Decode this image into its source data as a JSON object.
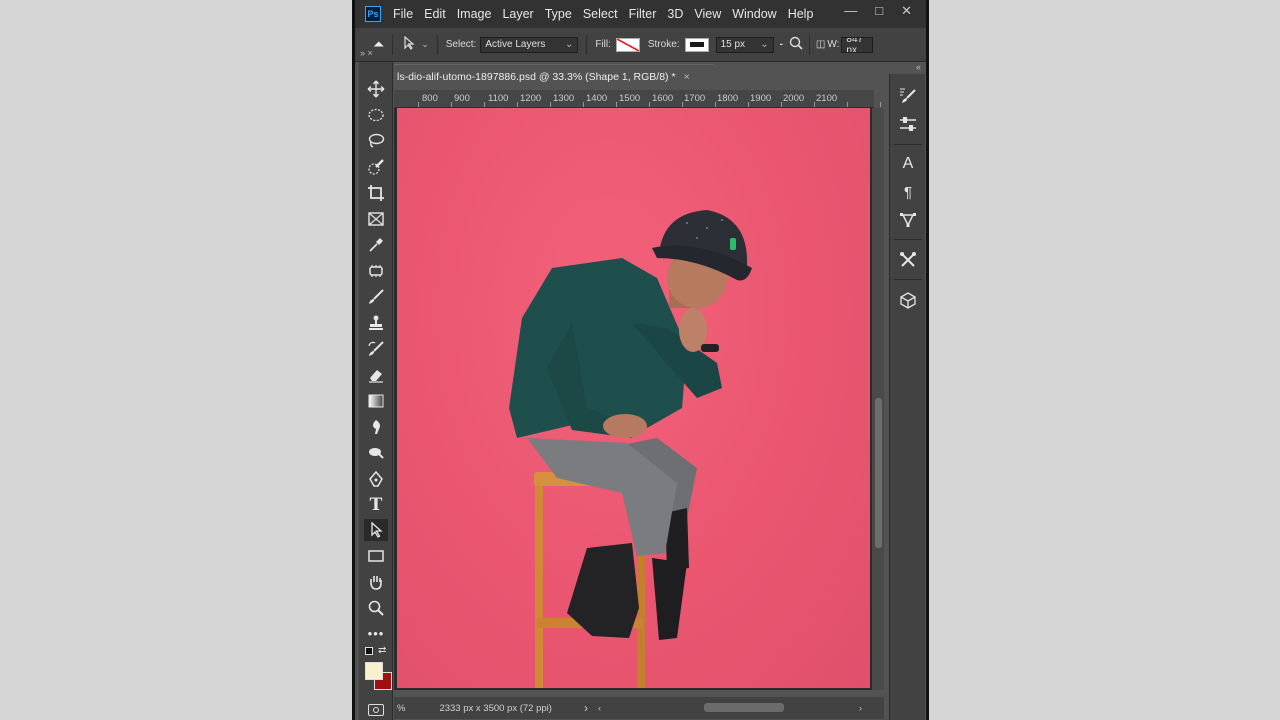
{
  "menubar": {
    "logo": "Ps",
    "items": [
      "File",
      "Edit",
      "Image",
      "Layer",
      "Type",
      "Select",
      "Filter",
      "3D",
      "View",
      "Window",
      "Help"
    ],
    "controls": [
      "—",
      "□",
      "✕"
    ]
  },
  "options": {
    "select_label": "Select:",
    "select_value": "Active Layers",
    "fill_label": "Fill:",
    "stroke_label": "Stroke:",
    "stroke_width": "15 px",
    "width_label": "W:",
    "width_value": "847 px"
  },
  "document": {
    "tab_title": "ls-dio-alif-utomo-1897886.psd @ 33.3% (Shape 1, RGB/8) *",
    "tab_close": "×",
    "ruler_labels": [
      "800",
      "900",
      "1100",
      "1200",
      "1300",
      "1400",
      "1500",
      "1600",
      "1700",
      "1800",
      "1900",
      "2000",
      "2100"
    ],
    "status_prefix": "%",
    "status_text": "2333 px x 3500 px (72 ppi)",
    "status_arrow": "›"
  },
  "toolstrip_head": "» ×",
  "rpanel_head": "«",
  "colors": {
    "background_photo": "#ea5670",
    "foreground_swatch": "#f7f1cf",
    "background_swatch": "#a01010",
    "menubar": "#323232",
    "panel": "#424242"
  },
  "tools": [
    "move-icon",
    "marquee-icon",
    "lasso-icon",
    "quick-select-icon",
    "crop-icon",
    "frame-icon",
    "eyedropper-icon",
    "patch-icon",
    "brush-icon",
    "stamp-icon",
    "history-brush-icon",
    "eraser-icon",
    "gradient-icon",
    "blur-icon",
    "dodge-icon",
    "pen-icon",
    "type-icon",
    "path-select-icon",
    "rectangle-icon",
    "hand-icon",
    "zoom-icon",
    "more-tools-icon"
  ],
  "right_panel_icons": [
    "brush-settings-icon",
    "adjustments-icon",
    "character-icon",
    "paragraph-icon",
    "paths-icon",
    "tools-icon",
    "3d-icon"
  ]
}
